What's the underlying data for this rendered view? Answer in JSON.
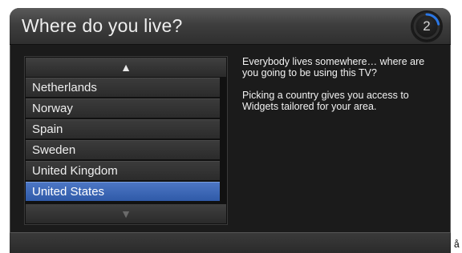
{
  "dialog": {
    "title": "Where do you live?",
    "step_number": "2"
  },
  "country_list": {
    "up_arrow_icon": "chevron-up",
    "down_arrow_icon": "chevron-down",
    "items": [
      {
        "label": "Netherlands",
        "selected": false
      },
      {
        "label": "Norway",
        "selected": false
      },
      {
        "label": "Spain",
        "selected": false
      },
      {
        "label": "Sweden",
        "selected": false
      },
      {
        "label": "United Kingdom",
        "selected": false
      },
      {
        "label": "United States",
        "selected": true
      }
    ],
    "selected_color": "#3b67b6"
  },
  "info": {
    "paragraph1": "Everybody lives somewhere… where are you going to be using this TV?",
    "paragraph2": "Picking a country gives you access to Widgets tailored for your area."
  },
  "corner_text": "å"
}
